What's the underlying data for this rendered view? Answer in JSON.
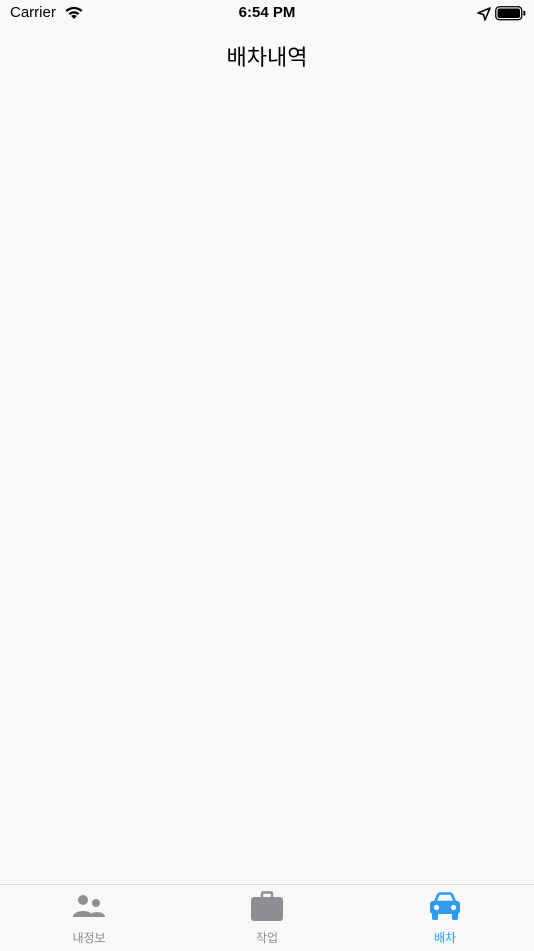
{
  "status_bar": {
    "carrier": "Carrier",
    "time": "6:54 PM"
  },
  "nav": {
    "title": "배차내역"
  },
  "tabs": [
    {
      "label": "내정보",
      "icon": "people-icon",
      "active": false
    },
    {
      "label": "작업",
      "icon": "briefcase-icon",
      "active": false
    },
    {
      "label": "배차",
      "icon": "car-icon",
      "active": true
    }
  ],
  "colors": {
    "active_tab": "#2f9bf0",
    "inactive_tab": "#8e8e93",
    "background": "#f9f9f9"
  }
}
